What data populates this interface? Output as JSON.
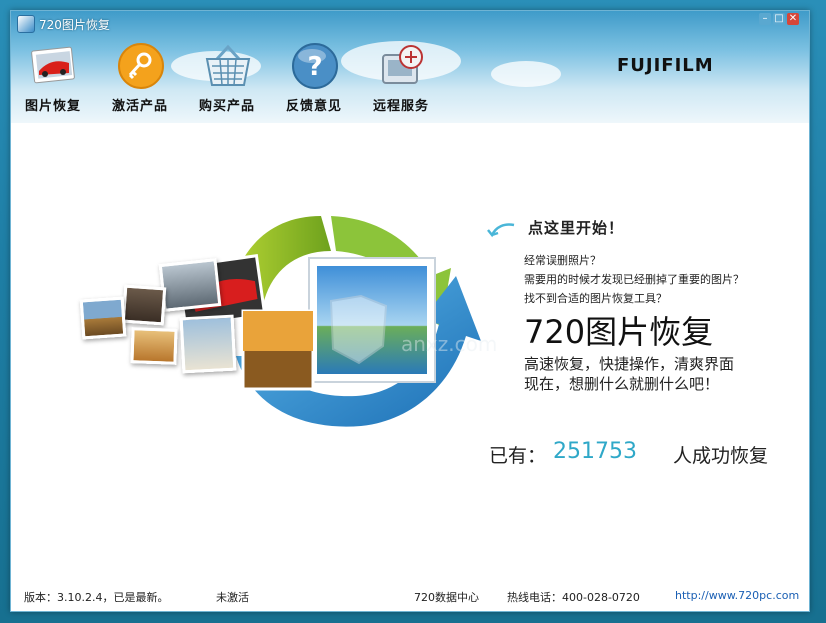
{
  "window": {
    "title": "720图片恢复"
  },
  "toolbar": {
    "items": [
      {
        "label": "图片恢复"
      },
      {
        "label": "激活产品"
      },
      {
        "label": "购买产品"
      },
      {
        "label": "反馈意见"
      },
      {
        "label": "远程服务"
      }
    ]
  },
  "brand": {
    "logo_text": "FUJIFILM"
  },
  "main": {
    "start_label": "点这里开始！",
    "questions": [
      "经常误删照片？",
      "需要用的时候才发现已经删掉了重要的图片？",
      "找不到合适的图片恢复工具？"
    ],
    "app_title": "720图片恢复",
    "description": [
      "高速恢复，快捷操作，清爽界面",
      "现在，想删什么就删什么吧！"
    ],
    "counter_prefix": "已有：",
    "counter_value": "251753",
    "counter_suffix": "人成功恢复"
  },
  "watermark": {
    "text": "anxz.com"
  },
  "status_bar": {
    "version": "版本：3.10.2.4，已是最新。",
    "activation": "未激活",
    "data_center": "720数据中心",
    "hotline": "热线电话：400-028-0720",
    "website": "http://www.720pc.com"
  },
  "colors": {
    "accent": "#2fa8c8",
    "link": "#1a5fb4",
    "brand_red": "#c8102e"
  },
  "icons": {
    "toolbar": [
      "photo-recovery-icon",
      "key-icon",
      "shopping-basket-icon",
      "question-icon",
      "remote-service-icon"
    ]
  }
}
